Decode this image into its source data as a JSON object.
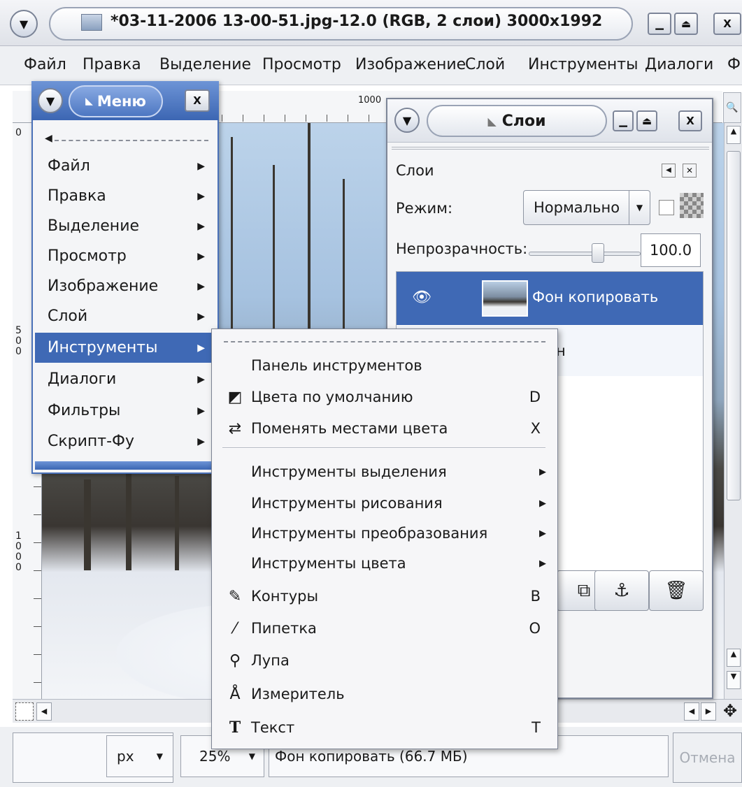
{
  "window": {
    "title": "*03-11-2006 13-00-51.jpg-12.0 (RGB, 2 слои) 3000x1992"
  },
  "menubar": [
    "Файл",
    "Правка",
    "Выделение",
    "Просмотр",
    "Изображение",
    "Слой",
    "Инструменты",
    "Диалоги",
    "Фи"
  ],
  "ruler": {
    "top_mark": "1000",
    "left_mark_500": "5 0 0",
    "left_mark_1000": "1 0 0 0",
    "left_zero": "0"
  },
  "menu_window": {
    "title": "Меню",
    "items": [
      {
        "label": "Файл"
      },
      {
        "label": "Правка"
      },
      {
        "label": "Выделение"
      },
      {
        "label": "Просмотр"
      },
      {
        "label": "Изображение"
      },
      {
        "label": "Слой"
      },
      {
        "label": "Инструменты",
        "selected": true
      },
      {
        "label": "Диалоги"
      },
      {
        "label": "Фильтры"
      },
      {
        "label": "Скрипт-Фу"
      }
    ]
  },
  "layers_window": {
    "title": "Слои",
    "section_label": "Слои",
    "mode_label": "Режим:",
    "mode_value": "Нормально",
    "opacity_label": "Непрозрачность:",
    "opacity_value": "100.0",
    "layers": [
      {
        "name": "Фон копировать",
        "selected": true
      },
      {
        "name": "н"
      }
    ]
  },
  "tools_submenu": {
    "items": [
      {
        "label": "Панель инструментов",
        "key": "",
        "icon": "",
        "submenu": false
      },
      {
        "label": "Цвета по умолчанию",
        "key": "D",
        "icon": "default-colors-icon",
        "submenu": false
      },
      {
        "label": "Поменять местами цвета",
        "key": "X",
        "icon": "swap-colors-icon",
        "submenu": false
      },
      {
        "label": "Инструменты выделения",
        "key": "",
        "icon": "",
        "submenu": true
      },
      {
        "label": "Инструменты рисования",
        "key": "",
        "icon": "",
        "submenu": true
      },
      {
        "label": "Инструменты преобразования",
        "key": "",
        "icon": "",
        "submenu": true
      },
      {
        "label": "Инструменты цвета",
        "key": "",
        "icon": "",
        "submenu": true
      },
      {
        "label": "Контуры",
        "key": "B",
        "icon": "paths-icon",
        "submenu": false
      },
      {
        "label": "Пипетка",
        "key": "O",
        "icon": "eyedropper-icon",
        "submenu": false
      },
      {
        "label": "Лупа",
        "key": "",
        "icon": "magnify-icon",
        "submenu": false
      },
      {
        "label": "Измеритель",
        "key": "",
        "icon": "measure-icon",
        "submenu": false
      },
      {
        "label": "Текст",
        "key": "T",
        "icon": "text-icon",
        "submenu": false
      }
    ]
  },
  "statusbar": {
    "unit": "px",
    "zoom": "25%",
    "message": "Фон копировать (66.7 МБ)",
    "cancel": "Отмена"
  }
}
